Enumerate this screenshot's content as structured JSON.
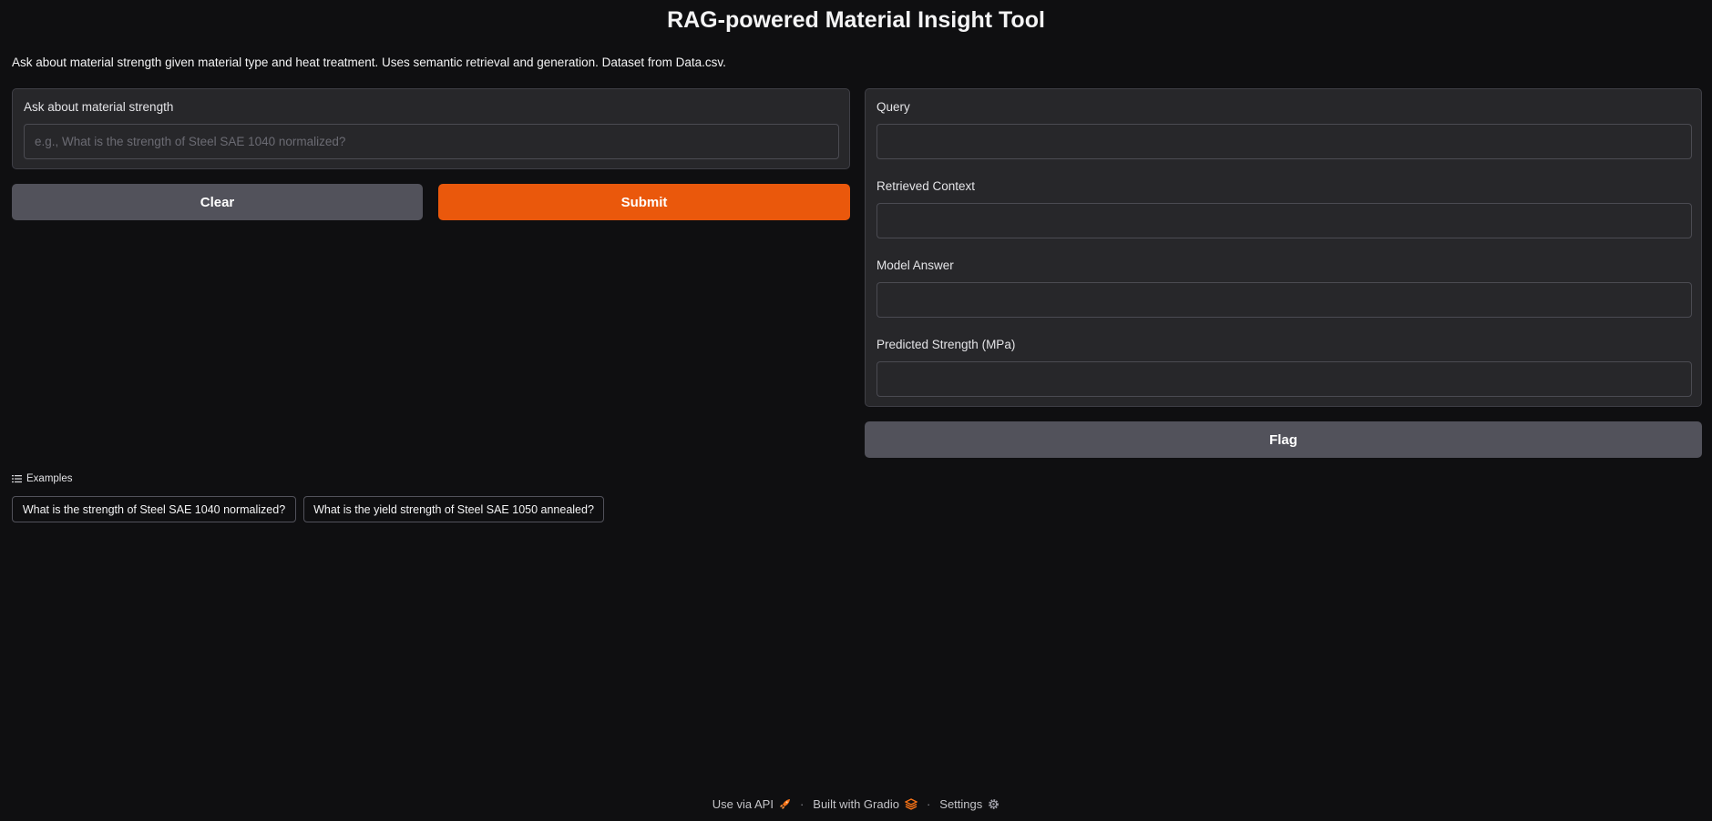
{
  "app": {
    "title": "RAG-powered Material Insight Tool",
    "description": "Ask about material strength given material type and heat treatment. Uses semantic retrieval and generation. Dataset from Data.csv."
  },
  "input_panel": {
    "label": "Ask about material strength",
    "value": "",
    "placeholder": "e.g., What is the strength of Steel SAE 1040 normalized?"
  },
  "buttons": {
    "clear_label": "Clear",
    "submit_label": "Submit",
    "flag_label": "Flag"
  },
  "output_panel": {
    "fields": [
      {
        "label": "Query",
        "value": ""
      },
      {
        "label": "Retrieved Context",
        "value": ""
      },
      {
        "label": "Model Answer",
        "value": ""
      },
      {
        "label": "Predicted Strength (MPa)",
        "value": ""
      }
    ]
  },
  "examples": {
    "header": "Examples",
    "header_icon": "list-icon",
    "items": [
      "What is the strength of Steel SAE 1040 normalized?",
      "What is the yield strength of Steel SAE 1050 annealed?"
    ]
  },
  "footer": {
    "api_label": "Use via API",
    "api_icon": "rocket-icon",
    "built_label": "Built with Gradio",
    "built_icon": "gradio-logo-icon",
    "settings_label": "Settings",
    "settings_icon": "gear-icon",
    "separator": "·"
  },
  "colors": {
    "background": "#0f0f11",
    "panel": "#27272a",
    "primary": "#ea580c",
    "secondary": "#52525b"
  }
}
